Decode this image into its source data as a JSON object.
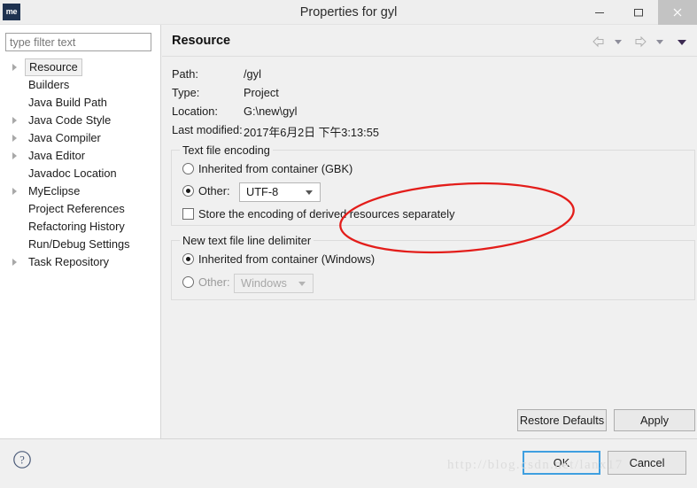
{
  "window": {
    "title": "Properties for gyl",
    "app_icon_label": "me",
    "controls": {
      "minimize": "minimize-icon",
      "maximize": "maximize-icon",
      "close": "close-icon"
    }
  },
  "sidebar": {
    "filter_placeholder": "type filter text",
    "filter_value": "",
    "items": [
      {
        "label": "Resource",
        "expandable": true,
        "selected": true
      },
      {
        "label": "Builders",
        "expandable": false,
        "selected": false
      },
      {
        "label": "Java Build Path",
        "expandable": false,
        "selected": false
      },
      {
        "label": "Java Code Style",
        "expandable": true,
        "selected": false
      },
      {
        "label": "Java Compiler",
        "expandable": true,
        "selected": false
      },
      {
        "label": "Java Editor",
        "expandable": true,
        "selected": false
      },
      {
        "label": "Javadoc Location",
        "expandable": false,
        "selected": false
      },
      {
        "label": "MyEclipse",
        "expandable": true,
        "selected": false
      },
      {
        "label": "Project References",
        "expandable": false,
        "selected": false
      },
      {
        "label": "Refactoring History",
        "expandable": false,
        "selected": false
      },
      {
        "label": "Run/Debug Settings",
        "expandable": false,
        "selected": false
      },
      {
        "label": "Task Repository",
        "expandable": true,
        "selected": false
      }
    ]
  },
  "page": {
    "title": "Resource",
    "nav": {
      "back": "back-arrow-icon",
      "back_menu": "chevron-down-icon",
      "forward": "forward-arrow-icon",
      "forward_menu": "chevron-down-icon",
      "view_menu": "view-menu-icon"
    },
    "info": {
      "path_label": "Path:",
      "path_value": "/gyl",
      "type_label": "Type:",
      "type_value": "Project",
      "location_label": "Location:",
      "location_value": "G:\\new\\gyl",
      "modified_label": "Last modified:",
      "modified_value": "2017年6月2日 下午3:13:55"
    },
    "encoding_group": {
      "title": "Text file encoding",
      "inherited_label": "Inherited from container (GBK)",
      "inherited_checked": false,
      "other_label": "Other:",
      "other_checked": true,
      "other_value": "UTF-8",
      "store_label": "Store the encoding of derived resources separately",
      "store_checked": false
    },
    "delimiter_group": {
      "title": "New text file line delimiter",
      "inherited_label": "Inherited from container (Windows)",
      "inherited_checked": true,
      "other_label": "Other:",
      "other_checked": false,
      "other_value": "Windows",
      "other_disabled": true
    },
    "restore_defaults_label": "Restore Defaults",
    "apply_label": "Apply"
  },
  "footer": {
    "help_icon": "help-icon",
    "ok_label": "OK",
    "cancel_label": "Cancel"
  },
  "watermark": "http://blog.csdn.net/lanx17",
  "colors": {
    "annotation_red": "#e31d1a",
    "focus_blue": "#3f9fe0",
    "brand_navy": "#1e3250"
  }
}
